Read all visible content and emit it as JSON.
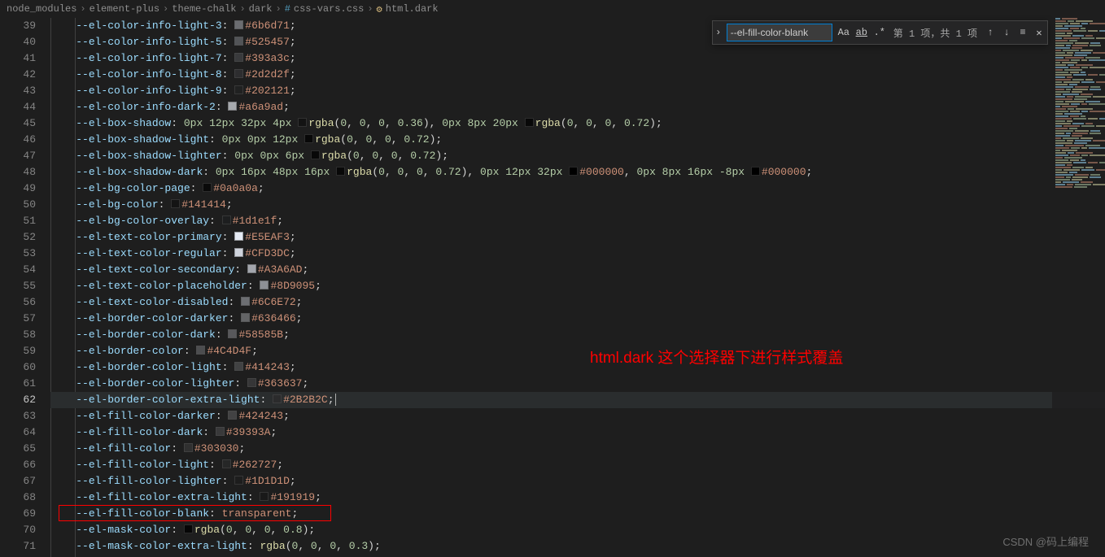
{
  "breadcrumb": [
    "node_modules",
    "element-plus",
    "theme-chalk",
    "dark",
    "css-vars.css",
    "html.dark"
  ],
  "find": {
    "value": "--el-fill-color-blank",
    "count_text": "第 1 项，共 1 项"
  },
  "annotation_text": "html.dark 这个选择器下进行样式覆盖",
  "watermark": "CSDN @码上编程",
  "current_line": 62,
  "highlighted_line": 69,
  "lines": [
    {
      "n": 39,
      "prop": "--el-color-info-light-3",
      "swatch": "#6b6d71",
      "hex": "#6b6d71"
    },
    {
      "n": 40,
      "prop": "--el-color-info-light-5",
      "swatch": "#525457",
      "hex": "#525457"
    },
    {
      "n": 41,
      "prop": "--el-color-info-light-7",
      "swatch": "#393a3c",
      "hex": "#393a3c"
    },
    {
      "n": 42,
      "prop": "--el-color-info-light-8",
      "swatch": "#2d2d2f",
      "hex": "#2d2d2f"
    },
    {
      "n": 43,
      "prop": "--el-color-info-light-9",
      "swatch": "#202121",
      "hex": "#202121"
    },
    {
      "n": 44,
      "prop": "--el-color-info-dark-2",
      "swatch": "#a6a9ad",
      "hex": "#a6a9ad"
    },
    {
      "n": 45,
      "prop": "--el-box-shadow",
      "raw": "0px 12px 32px 4px □rgba(0, 0, 0, 0.36), 0px 8px 20px □rgba(0, 0, 0, 0.72)",
      "shadow": true,
      "parts": [
        {
          "px": "0px 12px 32px 4px "
        },
        {
          "sw": "rgba(0,0,0,0.36)"
        },
        {
          "fn": "rgba"
        },
        {
          "args": "0, 0, 0, 0.36"
        },
        {
          "t": ", "
        },
        {
          "px": "0px 8px 20px "
        },
        {
          "sw": "rgba(0,0,0,0.72)"
        },
        {
          "fn": "rgba"
        },
        {
          "args": "0, 0, 0, 0.72"
        }
      ]
    },
    {
      "n": 46,
      "prop": "--el-box-shadow-light",
      "shadow": true,
      "parts": [
        {
          "px": "0px 0px 12px "
        },
        {
          "sw": "rgba(0,0,0,0.72)"
        },
        {
          "fn": "rgba"
        },
        {
          "args": "0, 0, 0, 0.72"
        }
      ]
    },
    {
      "n": 47,
      "prop": "--el-box-shadow-lighter",
      "shadow": true,
      "parts": [
        {
          "px": "0px 0px 6px "
        },
        {
          "sw": "rgba(0,0,0,0.72)"
        },
        {
          "fn": "rgba"
        },
        {
          "args": "0, 0, 0, 0.72"
        }
      ]
    },
    {
      "n": 48,
      "prop": "--el-box-shadow-dark",
      "shadow": true,
      "parts": [
        {
          "px": "0px 16px 48px 16px "
        },
        {
          "sw": "rgba(0,0,0,0.72)"
        },
        {
          "fn": "rgba"
        },
        {
          "args": "0, 0, 0, 0.72"
        },
        {
          "t": ", "
        },
        {
          "px": "0px 12px 32px "
        },
        {
          "sw": "#000000"
        },
        {
          "hex": "#000000"
        },
        {
          "t": ", "
        },
        {
          "px": "0px 8px 16px -8px "
        },
        {
          "sw": "#000000"
        },
        {
          "hex": "#000000"
        }
      ]
    },
    {
      "n": 49,
      "prop": "--el-bg-color-page",
      "swatch": "#0a0a0a",
      "hex": "#0a0a0a"
    },
    {
      "n": 50,
      "prop": "--el-bg-color",
      "swatch": "#141414",
      "hex": "#141414"
    },
    {
      "n": 51,
      "prop": "--el-bg-color-overlay",
      "swatch": "#1d1e1f",
      "hex": "#1d1e1f"
    },
    {
      "n": 52,
      "prop": "--el-text-color-primary",
      "swatch": "#E5EAF3",
      "hex": "#E5EAF3"
    },
    {
      "n": 53,
      "prop": "--el-text-color-regular",
      "swatch": "#CFD3DC",
      "hex": "#CFD3DC"
    },
    {
      "n": 54,
      "prop": "--el-text-color-secondary",
      "swatch": "#A3A6AD",
      "hex": "#A3A6AD"
    },
    {
      "n": 55,
      "prop": "--el-text-color-placeholder",
      "swatch": "#8D9095",
      "hex": "#8D9095"
    },
    {
      "n": 56,
      "prop": "--el-text-color-disabled",
      "swatch": "#6C6E72",
      "hex": "#6C6E72"
    },
    {
      "n": 57,
      "prop": "--el-border-color-darker",
      "swatch": "#636466",
      "hex": "#636466"
    },
    {
      "n": 58,
      "prop": "--el-border-color-dark",
      "swatch": "#58585B",
      "hex": "#58585B"
    },
    {
      "n": 59,
      "prop": "--el-border-color",
      "swatch": "#4C4D4F",
      "hex": "#4C4D4F"
    },
    {
      "n": 60,
      "prop": "--el-border-color-light",
      "swatch": "#414243",
      "hex": "#414243"
    },
    {
      "n": 61,
      "prop": "--el-border-color-lighter",
      "swatch": "#363637",
      "hex": "#363637"
    },
    {
      "n": 62,
      "prop": "--el-border-color-extra-light",
      "swatch": "#2B2B2C",
      "hex": "#2B2B2C",
      "cursor": true
    },
    {
      "n": 63,
      "prop": "--el-fill-color-darker",
      "swatch": "#424243",
      "hex": "#424243"
    },
    {
      "n": 64,
      "prop": "--el-fill-color-dark",
      "swatch": "#39393A",
      "hex": "#39393A"
    },
    {
      "n": 65,
      "prop": "--el-fill-color",
      "swatch": "#303030",
      "hex": "#303030"
    },
    {
      "n": 66,
      "prop": "--el-fill-color-light",
      "swatch": "#262727",
      "hex": "#262727"
    },
    {
      "n": 67,
      "prop": "--el-fill-color-lighter",
      "swatch": "#1D1D1D",
      "hex": "#1D1D1D"
    },
    {
      "n": 68,
      "prop": "--el-fill-color-extra-light",
      "swatch": "#191919",
      "hex": "#191919"
    },
    {
      "n": 69,
      "prop": "--el-fill-color-blank",
      "kw": "transparent"
    },
    {
      "n": 70,
      "prop": "--el-mask-color",
      "shadow": true,
      "parts": [
        {
          "sw": "rgba(0,0,0,0.8)"
        },
        {
          "fn": "rgba"
        },
        {
          "args": "0, 0, 0, 0.8"
        }
      ]
    },
    {
      "n": 71,
      "prop": "--el-mask-color-extra-light",
      "shadow": true,
      "parts": [
        {
          "fn": "rgba"
        },
        {
          "args": "0, 0, 0, 0.3"
        }
      ]
    }
  ]
}
